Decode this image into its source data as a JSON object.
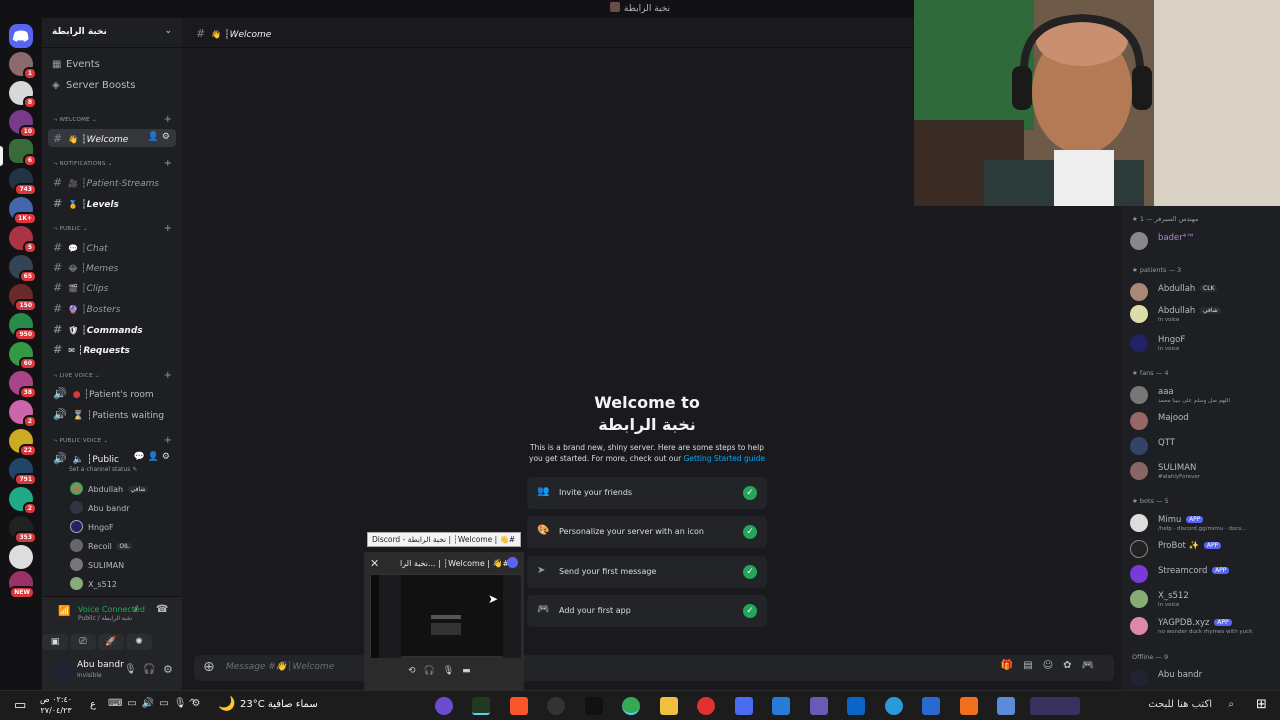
{
  "window": {
    "title": "نخبة الرابطة"
  },
  "server": {
    "name": "نخبة الرابطة"
  },
  "rail_badges": [
    "1",
    "8",
    "10",
    "6",
    "743",
    "1K+",
    "5",
    "65",
    "150",
    "950",
    "60",
    "38",
    "2",
    "22",
    "791",
    "2",
    "353",
    "NEW"
  ],
  "sidebar": {
    "nav": [
      {
        "icon": "calendar-icon",
        "label": "Events"
      },
      {
        "icon": "boost-icon",
        "label": "Server Boosts"
      }
    ],
    "categories": {
      "welcome": "WELCOME",
      "notifications": "NOTIFICATIONS",
      "public": "PUBLIC",
      "live_voice": "LIVE VOICE",
      "public_voice": "PUBLIC VOICE"
    },
    "channels": {
      "welcome": {
        "emoji": "👋",
        "label": "┆Welcome"
      },
      "patient_streams": {
        "emoji": "🎥",
        "label": "┆Patient-Streams"
      },
      "levels": {
        "emoji": "🏅",
        "label": "┆Levels"
      },
      "chat": {
        "emoji": "💬",
        "label": "┆Chat"
      },
      "memes": {
        "emoji": "😂",
        "label": "┆Memes"
      },
      "clips": {
        "emoji": "🎬",
        "label": "┆Clips"
      },
      "bosters": {
        "emoji": "🔮",
        "label": "┆Bosters"
      },
      "commands": {
        "emoji": "🛡",
        "label": "┆Commands"
      },
      "requests": {
        "emoji": "✉",
        "label": "┆Requests"
      }
    },
    "voice_channels": {
      "patients_room": "┆Patient's room",
      "patients_waiting": "┆Patients waiting",
      "public": "┆Public",
      "public_status": "Set a channel status"
    },
    "voice_users": [
      {
        "name": "Abdullah",
        "tag": "شافي"
      },
      {
        "name": "Abu bandr",
        "tag": ""
      },
      {
        "name": "HngoF",
        "tag": ""
      },
      {
        "name": "Recoil",
        "tag": "OIL"
      },
      {
        "name": "SULIMAN",
        "tag": ""
      },
      {
        "name": "X_s512",
        "tag": ""
      }
    ]
  },
  "voice_panel": {
    "status": "Voice Connected",
    "location": "Public / نخبة الرابطة"
  },
  "user": {
    "name": "Abu bandr",
    "status": "Invisible"
  },
  "header": {
    "channel": "┆Welcome",
    "emoji": "👋"
  },
  "welcome": {
    "title_line1": "Welcome to",
    "title_line2": "نخبة الرابطة",
    "desc": "This is a brand new, shiny server. Here are some steps to help you get started. For more, check out our",
    "link": "Getting Started guide",
    "tasks": [
      {
        "label": "Invite your friends",
        "icon": "invite-icon"
      },
      {
        "label": "Personalize your server with an icon",
        "icon": "palette-icon"
      },
      {
        "label": "Send your first message",
        "icon": "send-icon"
      },
      {
        "label": "Add your first app",
        "icon": "controller-icon"
      }
    ]
  },
  "composer": {
    "placeholder": "Message #👋┆Welcome"
  },
  "taskbar_preview": {
    "tooltip": "Discord - نخبة الرابطة | ┆Welcome | 👋#",
    "title": "نخبة الرا... | ┆Welcome | 👋#"
  },
  "members": {
    "groups": {
      "g1": "مهندس السيرفر — 1",
      "patients": "patients — 3",
      "fans": "fans — 4",
      "bots": "bots — 5",
      "offline": "Offline — 9"
    },
    "list": [
      {
        "name": "bader⁴™",
        "status": "",
        "badge": ""
      },
      {
        "name": "Abdullah",
        "status": "",
        "badge": "CLK"
      },
      {
        "name": "Abdullah",
        "status": "In voice",
        "badge": "شافي"
      },
      {
        "name": "HngoF",
        "status": "In voice",
        "badge": ""
      },
      {
        "name": "aaa",
        "status": "اللهم صل وسلم على نبينا محمد",
        "badge": ""
      },
      {
        "name": "Majood",
        "status": "",
        "badge": ""
      },
      {
        "name": "QTT",
        "status": "",
        "badge": ""
      },
      {
        "name": "SULIMAN",
        "status": "#alahlyForever",
        "badge": ""
      },
      {
        "name": "Mimu",
        "status": "/help · discord.gg/mimu · docs...",
        "badge": "APP"
      },
      {
        "name": "ProBot ✨",
        "status": "",
        "badge": "APP"
      },
      {
        "name": "Streamcord",
        "status": "",
        "badge": "APP"
      },
      {
        "name": "X_s512",
        "status": "In voice",
        "badge": ""
      },
      {
        "name": "YAGPDB.xyz",
        "status": "no wonder duck rhymes with yuck",
        "badge": "APP"
      },
      {
        "name": "Abu bandr",
        "status": "",
        "badge": ""
      }
    ]
  },
  "taskbar": {
    "time": "٠٢:٤٠ ص",
    "date": "٢٧/٠٤/٢٣",
    "lang": "ع",
    "weather_temp": "23°C",
    "weather_desc": "سماء صافية",
    "search": "اكتب هنا للبحث"
  },
  "colors": {
    "accent": "#5865f2",
    "online": "#23a55a",
    "badge": "#da373c"
  }
}
